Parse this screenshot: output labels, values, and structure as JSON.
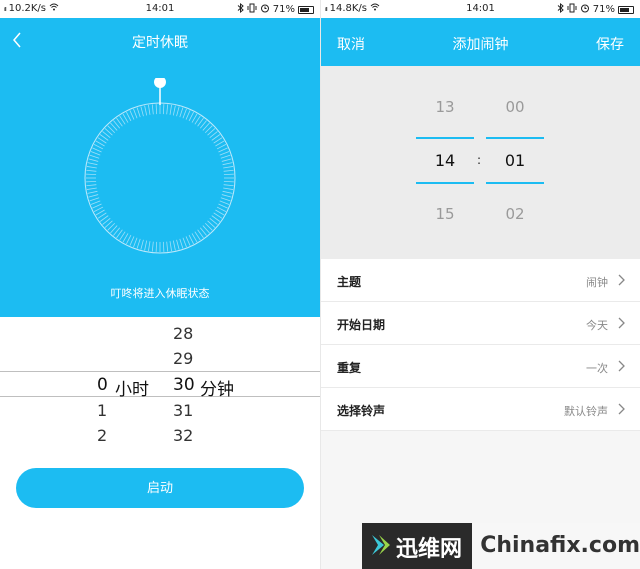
{
  "colors": {
    "accent": "#1cbcf2",
    "text": "#333333",
    "muted": "#888888"
  },
  "left_screen": {
    "status": {
      "signal": "ᵢₗₗ",
      "speed": "10.2K/s",
      "time": "14:01",
      "battery": "71%"
    },
    "title": "定时休眠",
    "back_icon": "chevron-left-icon",
    "message": "叮咚将进入休眠状态",
    "picker": {
      "hours": [
        {
          "value": "",
          "offset": -2
        },
        {
          "value": "",
          "offset": -1
        },
        {
          "value": "0",
          "offset": 0
        },
        {
          "value": "1",
          "offset": 1
        },
        {
          "value": "2",
          "offset": 2
        }
      ],
      "minutes": [
        "28",
        "29",
        "30",
        "31",
        "32"
      ],
      "hour_unit": "小时",
      "minute_unit": "分钟"
    },
    "start_label": "启动"
  },
  "right_screen": {
    "status": {
      "signal": "ᵢₗₗ",
      "speed": "14.8K/s",
      "time": "14:01",
      "battery": "71%"
    },
    "cancel_label": "取消",
    "title": "添加闹钟",
    "save_label": "保存",
    "time_picker": {
      "hours": [
        "13",
        "14",
        "15"
      ],
      "minutes": [
        "00",
        "01",
        "02"
      ],
      "separator": ":"
    },
    "settings": [
      {
        "label": "主题",
        "value": "闹钟"
      },
      {
        "label": "开始日期",
        "value": "今天"
      },
      {
        "label": "重复",
        "value": "一次"
      },
      {
        "label": "选择铃声",
        "value": "默认铃声"
      }
    ]
  },
  "watermark": {
    "cn": "迅维网",
    "en": "Chinafix.com"
  }
}
